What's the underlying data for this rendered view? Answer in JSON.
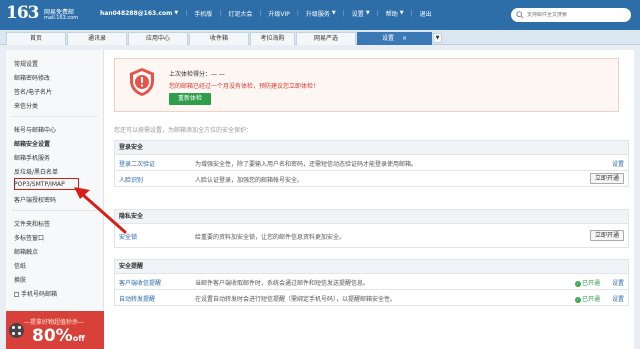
{
  "header": {
    "logo_number": "163",
    "logo_text": "网易免费邮",
    "logo_domain": "mail.163.com",
    "account_email": "han048288@163.com",
    "nav": [
      "手机版",
      "灯泥大会",
      "升级VIP",
      "升级服务",
      "设置",
      "帮助",
      "退出"
    ],
    "search_placeholder": "支持邮件全文搜索"
  },
  "tabs": [
    "首页",
    "通讯录",
    "应用中心",
    "收件箱",
    "考拉海购",
    "网易严选",
    "设置"
  ],
  "sidebar": {
    "group1": [
      "常规设置",
      "邮箱密码修改",
      "签名/电子名片",
      "来信分类"
    ],
    "group2": [
      "帐号与邮箱中心",
      "邮箱安全设置",
      "邮箱手机服务",
      "反垃圾/黑白名单",
      "POP3/SMTP/IMAP",
      "客户端授权密码"
    ],
    "group3": [
      "文件夹和标签",
      "多标签窗口",
      "邮箱触点",
      "信纸",
      "换肤",
      "手机号码邮箱"
    ],
    "promo_line1": "—提拿好物超值秒杀—",
    "promo_big": "80%",
    "promo_small": "off"
  },
  "main": {
    "alert": {
      "title": "上次体检得分：— —",
      "text": "您的邮箱已经过一个月没有体检，预防建议您立即体检！",
      "button": "重新体检"
    },
    "intro": "您还可以按需设置，为邮箱添加全方位的安全保护：",
    "sections": [
      {
        "title": "登录安全",
        "rows": [
          {
            "name": "登录二次验证",
            "desc": "为增强安全性，除了要输入用户名和密码，还需短信动态验证码才能登录使用邮箱。",
            "link": "设置"
          },
          {
            "name": "人脸识别",
            "desc": "人脸认证登录，加强您的邮箱帐号安全。",
            "button": "立即开通"
          }
        ]
      },
      {
        "title": "隐私安全",
        "rows": [
          {
            "name": "安全锁",
            "desc": "给重要的资料加安全锁，让您的邮件信息资料更加安全。",
            "button": "立即开通"
          }
        ]
      },
      {
        "title": "安全提醒",
        "rows": [
          {
            "name": "客户端收信提醒",
            "desc": "当邮件客户端收取邮件时，系统会通过邮件和短信发送提醒信息。",
            "status": "已开通",
            "link": "设置"
          },
          {
            "name": "自动转发提醒",
            "desc": "在设置自动转发时会进行短信提醒（需绑定手机号码），以提醒邮箱安全性。",
            "status": "已开通",
            "link": "设置"
          }
        ]
      }
    ]
  },
  "colors": {
    "header_blue": "#2d6ea8",
    "active_tab": "#3a78b6",
    "alert_red": "#e0362b",
    "ok_green": "#2f9d47",
    "annotation_red": "#d91e18"
  }
}
